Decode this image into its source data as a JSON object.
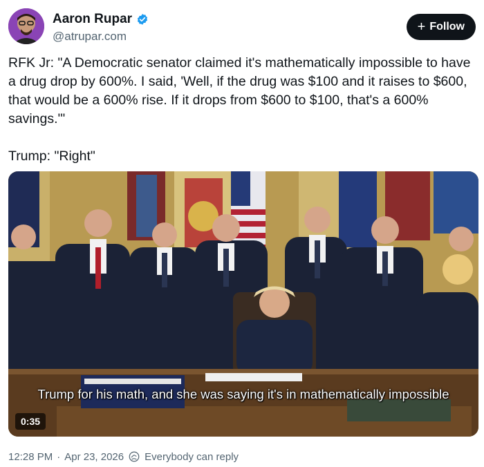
{
  "author": {
    "display_name": "Aaron Rupar",
    "handle": "@atrupar.com",
    "verified": true,
    "verified_color": "#1d9bf0"
  },
  "follow_button": {
    "label": "Follow",
    "icon": "plus-icon"
  },
  "tweet": {
    "text": "RFK Jr: \"A Democratic senator claimed it's mathematically impossible to have a drug drop by 600%. I said, 'Well, if the drug was $100 and it raises to $600, that would be a 600% rise. If it drops from $600 to $100, that's a 600% savings.'\"\n\nTrump: \"Right\""
  },
  "video": {
    "caption": "Trump for his math, and she was saying it's in mathematically impossible",
    "duration": "0:35"
  },
  "meta": {
    "time": "12:28 PM",
    "separator": "·",
    "date": "Apr 23, 2026",
    "reply_icon": "reply-audience-icon",
    "reply_setting": "Everybody can reply"
  }
}
